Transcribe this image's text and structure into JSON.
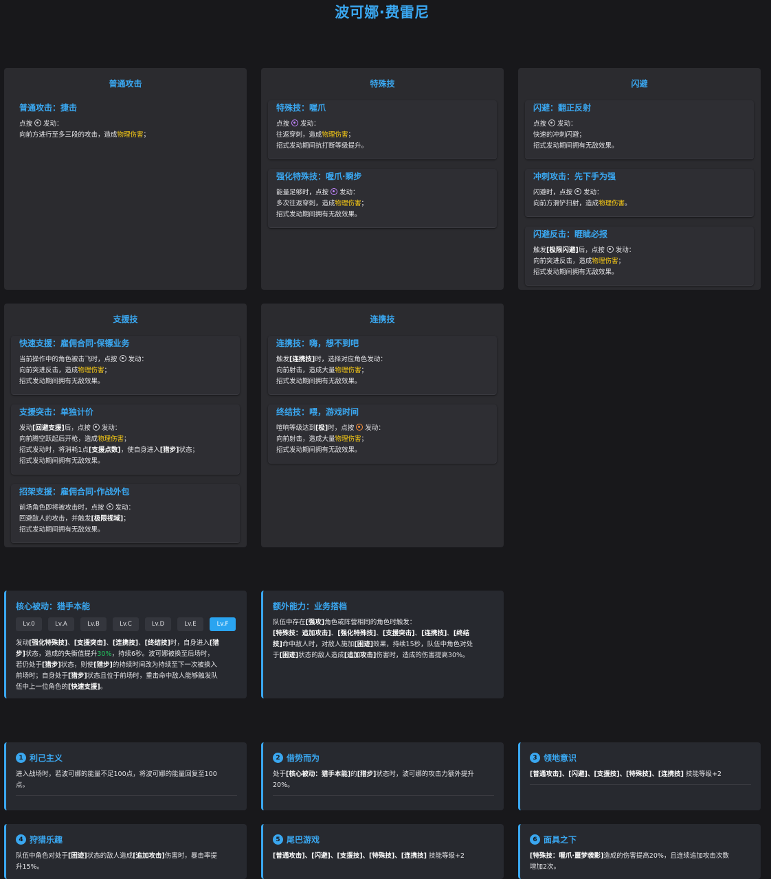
{
  "title": "波可娜·费雷尼",
  "panels": {
    "basic": {
      "title": "普通攻击",
      "skills": [
        {
          "name": "普通攻击：捷击",
          "l1a": "点按",
          "l1b": "发动：",
          "l2a": "向前方进行至多三段的攻击，造成",
          "l2hl": "物理伤害",
          "l2b": "；"
        }
      ]
    },
    "special": {
      "title": "特殊技",
      "skills": [
        {
          "name": "特殊技：喔爪",
          "l1a": "点按",
          "l1b": "发动：",
          "l2a": "往返穿刺，造成",
          "l2hl": "物理伤害",
          "l2b": "；",
          "l3": "招式发动期间抗打断等级提升。"
        },
        {
          "name": "强化特殊技：喔爪·瞬步",
          "l1a": "能量足够时，点按",
          "l1b": "发动：",
          "l2a": "多次往返穿刺，造成",
          "l2hl": "物理伤害",
          "l2b": "；",
          "l3": "招式发动期间拥有无敌效果。"
        }
      ]
    },
    "dodge": {
      "title": "闪避",
      "skills": [
        {
          "name": "闪避：翻正反射",
          "l1a": "点按",
          "l1b": "发动：",
          "l2": "快速的冲刺闪避；",
          "l3": "招式发动期间拥有无敌效果。"
        },
        {
          "name": "冲刺攻击：先下手为强",
          "l1a": "闪避时，点按",
          "l1b": "发动：",
          "l2a": "向前方滑铲扫射，造成",
          "l2hl": "物理伤害",
          "l2b": "。"
        },
        {
          "name": "闪避反击：睚眦必报",
          "l1pre": "触发",
          "l1k": "[极限闪避]",
          "l1a": "后，点按",
          "l1b": "发动：",
          "l2a": "向前突进反击，造成",
          "l2hl": "物理伤害",
          "l2b": "；",
          "l3": "招式发动期间拥有无敌效果。"
        }
      ]
    },
    "assist": {
      "title": "支援技",
      "skills": [
        {
          "name": "快速支援：雇佣合同·保镖业务",
          "l1a": "当前操作中的角色被击飞时，点按",
          "l1b": "发动：",
          "l2a": "向前突进反击，造成",
          "l2hl": "物理伤害",
          "l2b": "；",
          "l3": "招式发动期间拥有无敌效果。"
        },
        {
          "name": "支援突击：单独计价",
          "l1pre": "发动",
          "l1k": "[回避支援]",
          "l1a": "后，点按",
          "l1b": "发动：",
          "l2a": "向前腾空跃起后开枪，造成",
          "l2hl": "物理伤害",
          "l2b": "；",
          "l3a": "招式发动时，将消耗1点",
          "l3k": "[支援点数]",
          "l3b": "，使自身进入",
          "l3k2": "[猎步]",
          "l3c": "状态；",
          "l4": "招式发动期间拥有无敌效果。"
        },
        {
          "name": "招架支援：雇佣合同·作战外包",
          "l1a": "前场角色即将被攻击时，点按",
          "l1b": "发动：",
          "l2a": "回避敌人的攻击，并触发",
          "l2k": "[极限视域]",
          "l2b": "；",
          "l3": "招式发动期间拥有无敌效果。"
        }
      ]
    },
    "chain": {
      "title": "连携技",
      "skills": [
        {
          "name": "连携技：嗨，想不到吧",
          "l1pre": "触发",
          "l1k": "[连携技]",
          "l1a": "时，选择对应角色发动：",
          "l2a": "向前射击，造成大量",
          "l2hl": "物理伤害",
          "l2b": "；",
          "l3": "招式发动期间拥有无敌效果。"
        },
        {
          "name": "终结技：喂，游戏时间",
          "l1pre": "喧响等级达到",
          "l1k": "[极]",
          "l1a": "时，点按",
          "l1b": "发动：",
          "l2a": "向前射击，造成大量",
          "l2hl": "物理伤害",
          "l2b": "；",
          "l3": "招式发动期间拥有无敌效果。"
        }
      ]
    }
  },
  "core": {
    "title": "核心被动：猎手本能",
    "levels": [
      "Lv.0",
      "Lv.A",
      "Lv.B",
      "Lv.C",
      "Lv.D",
      "Lv.E",
      "Lv.F"
    ],
    "active_level": "Lv.F",
    "d1a": "发动",
    "d1k1": "[强化特殊技]",
    "d1s1": "、",
    "d1k2": "[支援突击]",
    "d1s2": "、",
    "d1k3": "[连携技]",
    "d1s3": "、",
    "d1k4": "[终结技]",
    "d1b": "时，自身进入",
    "d1k5": "[猎",
    "d2k": "步]",
    "d2a": "状态，造成的失衡值提升",
    "d2g": "30%",
    "d2b": "，持续6秒。波可娜被换至后场时，",
    "d3a": "若仍处于",
    "d3k": "[猎步]",
    "d3b": "状态，则使",
    "d3k2": "[猎步]",
    "d3c": "的持续时间改为持续至下一次被换入",
    "d4a": "前场时；自身处于",
    "d4k": "[猎步]",
    "d4b": "状态且位于前场时，重击命中敌人能够触发队",
    "d5a": "伍中上一位角色的",
    "d5k": "[快速支援]",
    "d5b": "。"
  },
  "extra": {
    "title": "额外能力：业务搭档",
    "d1a": "队伍中存在",
    "d1k": "[强攻]",
    "d1b": "角色或阵营相同的角色时触发：",
    "d2k1": "[特殊技：追加攻击]",
    "d2s1": "、",
    "d2k2": "[强化特殊技]",
    "d2s2": "、",
    "d2k3": "[支援突击]",
    "d2s3": "、",
    "d2k4": "[连携技]",
    "d2s4": "、",
    "d2k5": "[终结",
    "d3k": "技]",
    "d3a": "命中敌人时，对敌人施加",
    "d3k2": "[困迹]",
    "d3b": "效果，持续15秒，队伍中角色对处",
    "d4a": "于",
    "d4k": "[困迹]",
    "d4b": "状态的敌人造成",
    "d4k2": "[追加攻击]",
    "d4c": "伤害时，造成的伤害提高30%。"
  },
  "mindscapes": [
    {
      "num": "1",
      "name": "利己主义",
      "l1": "进入战场时，若波可娜的能量不足100点，将波可娜的能量回复至100",
      "l2": "点。"
    },
    {
      "num": "2",
      "name": "借势而为",
      "l1a": "处于",
      "l1k": "[核心被动：猎手本能]",
      "l1b": "的",
      "l1k2": "[猎步]",
      "l1c": "状态时，波可娜的攻击力额外提升",
      "l2": "20%。"
    },
    {
      "num": "3",
      "name": "领地意识",
      "l1k": "[普通攻击]、[闪避]、[支援技]、[特殊技]、[连携技]",
      "l1b": " 技能等级+2"
    },
    {
      "num": "4",
      "name": "狩猎乐趣",
      "l1a": "队伍中角色对处于",
      "l1k": "[困迹]",
      "l1b": "状态的敌人造成",
      "l1k2": "[追加攻击]",
      "l1c": "伤害时，暴击率提",
      "l2": "升15%。"
    },
    {
      "num": "5",
      "name": "尾巴游戏",
      "l1k": "[普通攻击]、[闪避]、[支援技]、[特殊技]、[连携技]",
      "l1b": " 技能等级+2"
    },
    {
      "num": "6",
      "name": "面具之下",
      "l1k": "[特殊技：喔爪·噩梦袭影]",
      "l1b": "造成的伤害提高20%，且连续追加攻击次数",
      "l2": "增加2次。"
    }
  ],
  "colors": {
    "accent": "#3aa7f0",
    "highlight": "#facc15",
    "green": "#22c55e",
    "background": "#18181b",
    "panel": "#2b2b2f"
  }
}
